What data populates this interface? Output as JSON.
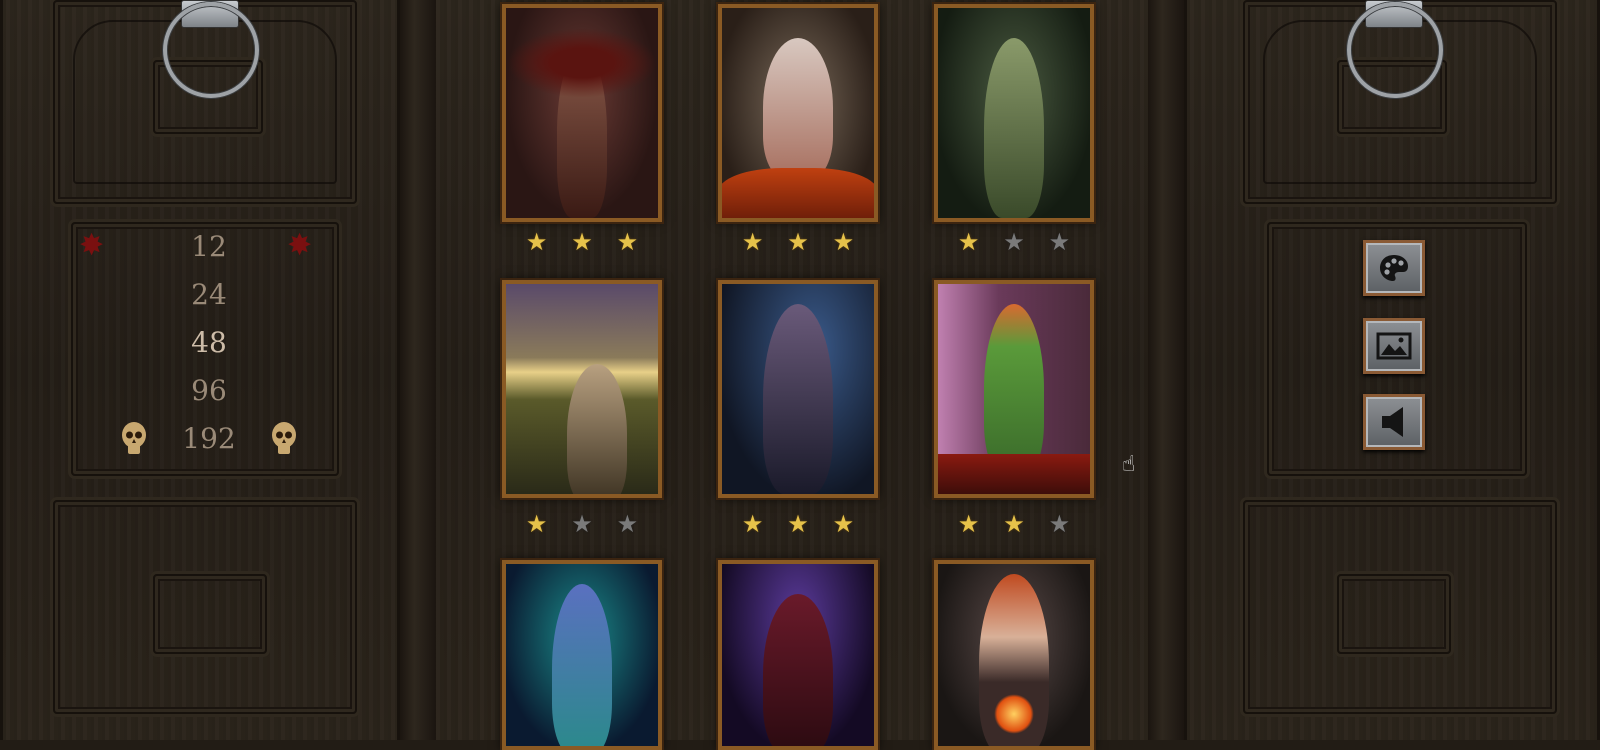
{
  "difficulty": {
    "options": [
      "12",
      "24",
      "48",
      "96",
      "192"
    ],
    "selected": "48"
  },
  "cards": [
    {
      "name": "winged demon",
      "stars": [
        1,
        1,
        1
      ]
    },
    {
      "name": "witch with pumpkins",
      "stars": [
        1,
        1,
        1
      ]
    },
    {
      "name": "forest dryad",
      "stars": [
        1,
        0,
        0
      ]
    },
    {
      "name": "sunset elf",
      "stars": [
        1,
        0,
        0
      ]
    },
    {
      "name": "dark succubus",
      "stars": [
        1,
        1,
        1
      ]
    },
    {
      "name": "red-haired archer",
      "stars": [
        1,
        1,
        0
      ]
    },
    {
      "name": "teal demoness",
      "stars": []
    },
    {
      "name": "horned sorceress",
      "stars": []
    },
    {
      "name": "fire maiden",
      "stars": []
    }
  ],
  "side_buttons": {
    "palette": "palette-icon",
    "gallery": "image-icon",
    "sound": "speaker-icon"
  },
  "colors": {
    "star_gold": "#e6c24a",
    "star_grey": "#7a7a7a",
    "frame": "#8a5a24"
  }
}
